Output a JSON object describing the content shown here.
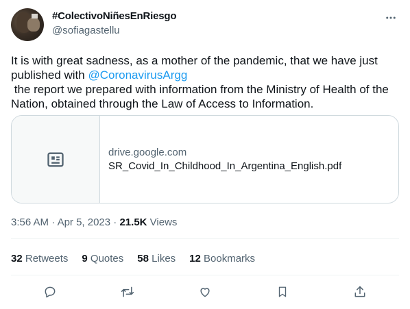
{
  "author": {
    "display_name": "#ColectivoNiñesEnRiesgo",
    "handle": "@sofiagastellu"
  },
  "tweet": {
    "line1": "It is with great sadness, as a mother of the pandemic, that we have just",
    "line2_prefix": "published with ",
    "mention": "@CoronavirusArgg",
    "line3": " the report we prepared with information from the Ministry of Health of the",
    "line4": "Nation, obtained through the Law of Access to Information."
  },
  "card": {
    "domain": "drive.google.com",
    "title": "SR_Covid_In_Childhood_In_Argentina_English.pdf",
    "icon": "article-icon"
  },
  "meta": {
    "time": "3:56 AM",
    "separator": " · ",
    "date": "Apr 5, 2023",
    "views_count": "21.5K",
    "views_label": " Views"
  },
  "stats": {
    "retweets": {
      "count": "32",
      "label": "Retweets"
    },
    "quotes": {
      "count": "9",
      "label": "Quotes"
    },
    "likes": {
      "count": "58",
      "label": "Likes"
    },
    "bookmarks": {
      "count": "12",
      "label": "Bookmarks"
    }
  },
  "actions": {
    "icons": [
      "reply-icon",
      "retweet-icon",
      "like-icon",
      "bookmark-icon",
      "share-icon"
    ]
  },
  "colors": {
    "text": "#0f1419",
    "secondary": "#536471",
    "link": "#1d9bf0",
    "border": "#cfd9de",
    "divider": "#eff3f4"
  }
}
